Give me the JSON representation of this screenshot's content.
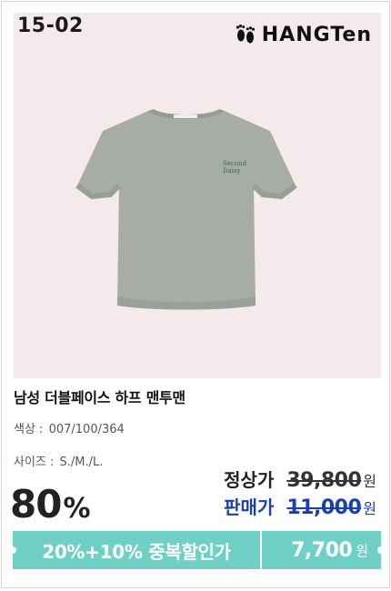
{
  "header": {
    "code": "15-02",
    "brand": "HANGTen",
    "brand_icon": "footprints-icon"
  },
  "product": {
    "title": "남성 더블페이스 하프 맨투맨",
    "image": "tshirt-image",
    "shirt_color": "#a7ada4",
    "print_text": "Second Daisy Smiley",
    "color_label": "색상 :",
    "color_value": "007/100/364",
    "size_label": "사이즈 :",
    "size_value": "S./M./L."
  },
  "pricing": {
    "discount_number": "80",
    "discount_unit": "%",
    "regular_label": "정상가",
    "regular_price": "39,800",
    "regular_unit": "원",
    "sale_label": "판매가",
    "sale_price": "11,000",
    "sale_unit": "원"
  },
  "banner": {
    "promo_text": "20%+10% 중복할인가",
    "final_price": "7,700",
    "final_unit": "원",
    "accent": "#6fd0c6"
  }
}
